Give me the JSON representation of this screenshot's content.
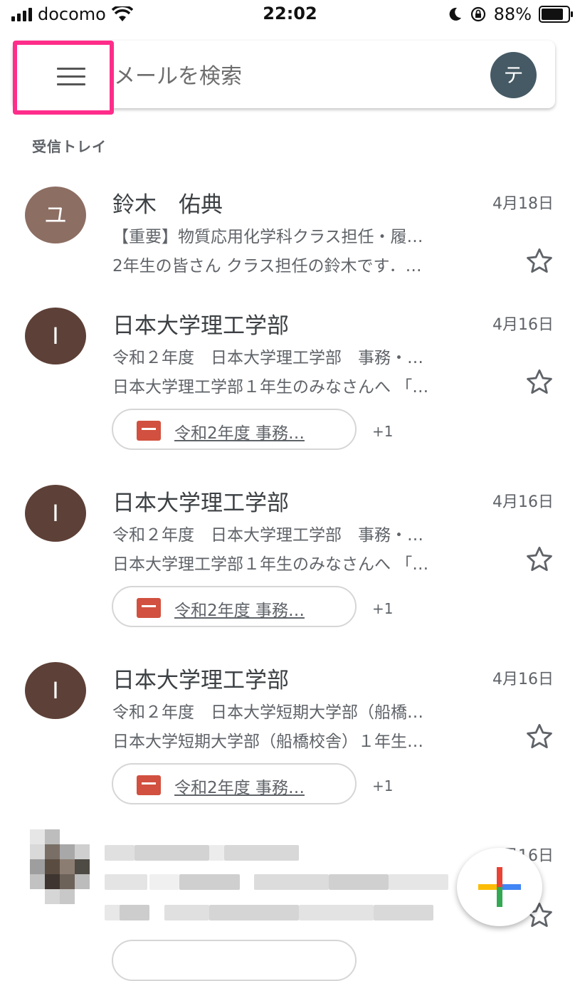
{
  "status_bar": {
    "carrier": "docomo",
    "time": "22:02",
    "battery": "88%"
  },
  "search": {
    "placeholder": "メールを検索",
    "account_initial": "テ"
  },
  "section_label": "受信トレイ",
  "emails": [
    {
      "avatar_initial": "ユ",
      "avatar_color": "#8d6e63",
      "sender": "鈴木　佑典",
      "date": "4月18日",
      "subject": "【重要】物質応用化学科クラス担任・履…",
      "snippet": "2年生の皆さん クラス担任の鈴木です．…"
    },
    {
      "avatar_initial": "I",
      "avatar_color": "#5d4037",
      "sender": "日本大学理工学部",
      "date": "4月16日",
      "subject": "令和２年度　日本大学理工学部　事務・…",
      "snippet": "日本大学理工学部１年生のみなさんへ 「…",
      "attachment": "令和2年度 事務…",
      "extra_count": "+1"
    },
    {
      "avatar_initial": "I",
      "avatar_color": "#5d4037",
      "sender": "日本大学理工学部",
      "date": "4月16日",
      "subject": "令和２年度　日本大学理工学部　事務・…",
      "snippet": "日本大学理工学部１年生のみなさんへ 「…",
      "attachment": "令和2年度 事務…",
      "extra_count": "+1"
    },
    {
      "avatar_initial": "I",
      "avatar_color": "#5d4037",
      "sender": "日本大学理工学部",
      "date": "4月16日",
      "subject": "令和２年度　日本大学短期大学部（船橋…",
      "snippet": "日本大学短期大学部（船橋校舎）１年生…",
      "attachment": "令和2年度 事務…",
      "extra_count": "+1"
    },
    {
      "date": "4月16日"
    }
  ],
  "icons": {
    "menu": "hamburger-icon",
    "star": "star-outline-icon",
    "attachment": "document-icon",
    "compose": "plus-icon"
  },
  "colors": {
    "highlight": "#ff2d8a",
    "attachment_icon": "#d1503f"
  }
}
